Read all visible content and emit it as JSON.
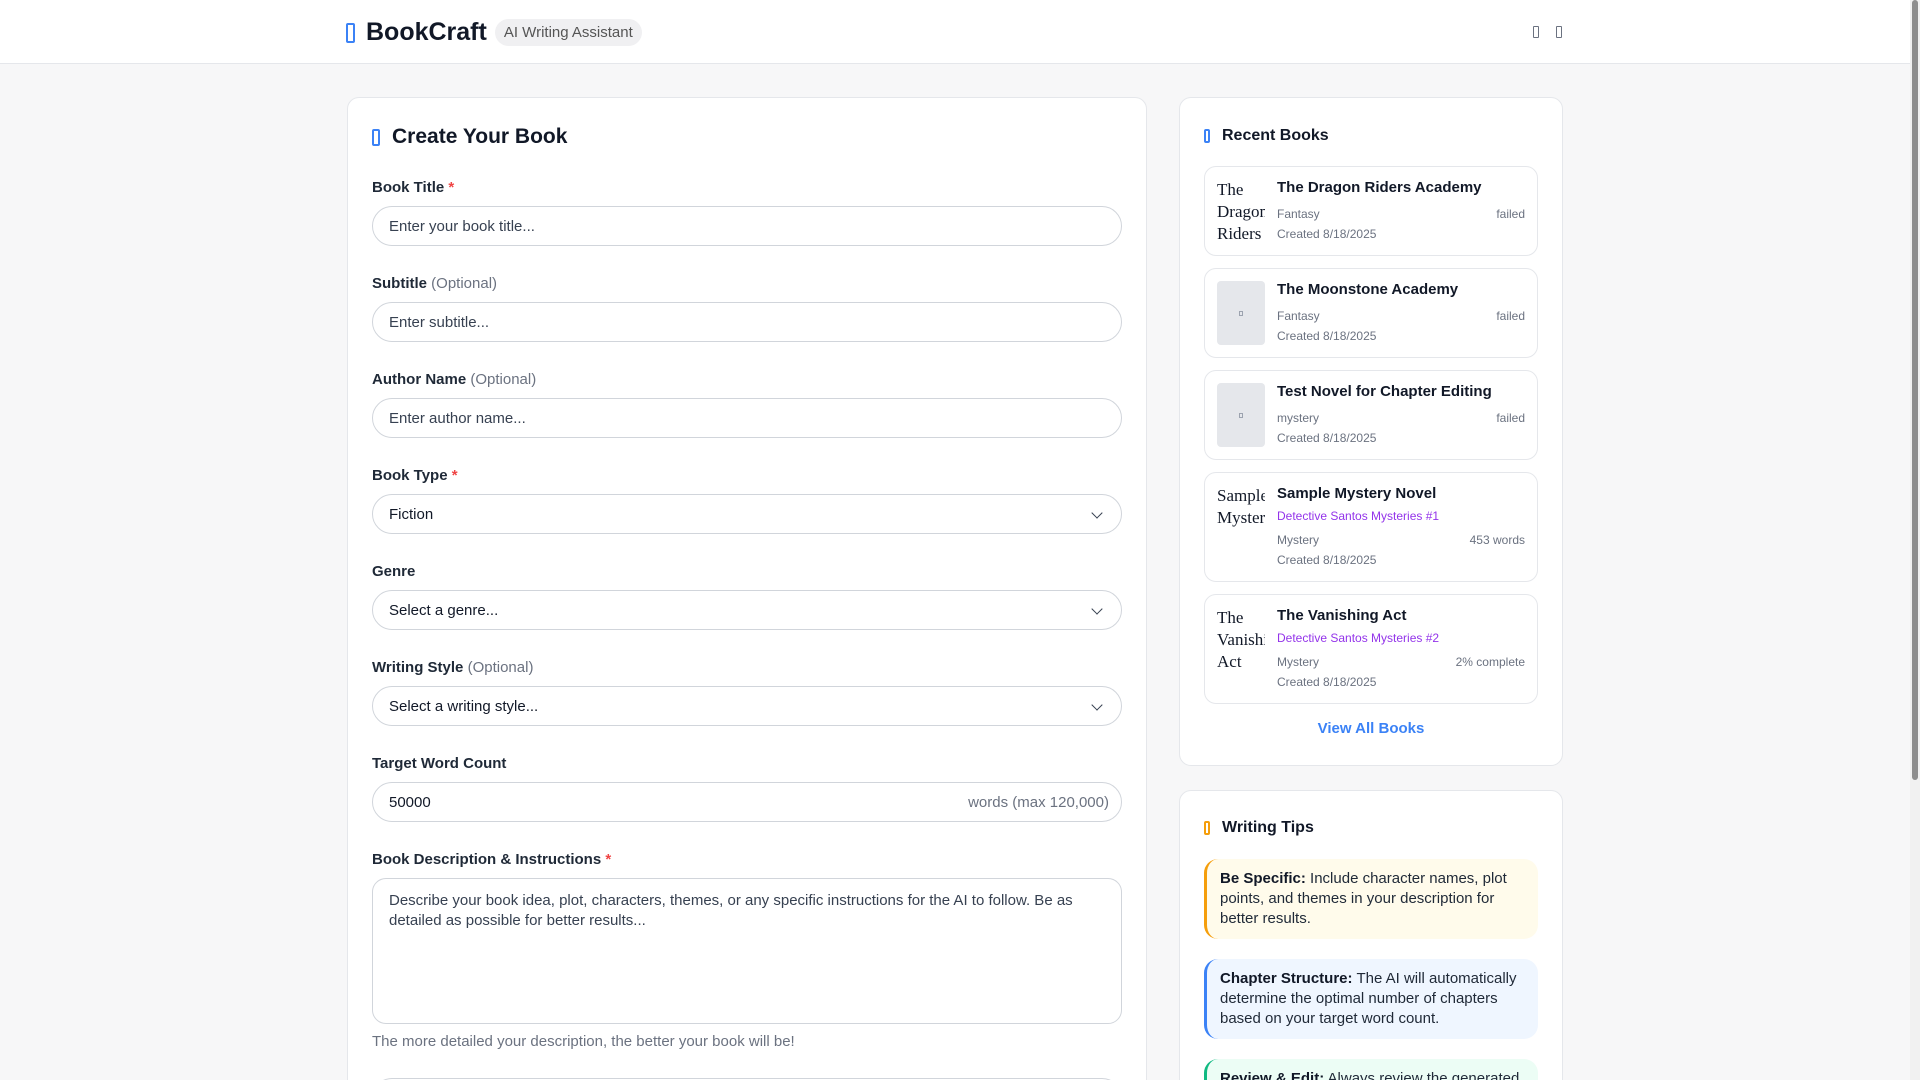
{
  "header": {
    "brand_name": "BookCraft",
    "brand_tag": "AI Writing Assistant",
    "brand_icon": "book-icon",
    "right_icons": [
      "user-icon",
      "menu-icon"
    ]
  },
  "form": {
    "title": "Create Your Book",
    "title_icon": "book-icon",
    "book_title": {
      "label": "Book Title",
      "required": "*",
      "placeholder": "Enter your book title..."
    },
    "subtitle": {
      "label": "Subtitle",
      "optional": "(Optional)",
      "placeholder": "Enter subtitle..."
    },
    "author": {
      "label": "Author Name",
      "optional": "(Optional)",
      "placeholder": "Enter author name..."
    },
    "book_type": {
      "label": "Book Type",
      "required": "*",
      "value": "Fiction"
    },
    "genre": {
      "label": "Genre",
      "value": "Select a genre..."
    },
    "writing_style": {
      "label": "Writing Style",
      "optional": "(Optional)",
      "value": "Select a writing style..."
    },
    "word_count": {
      "label": "Target Word Count",
      "value": "50000",
      "suffix": "words (max 120,000)"
    },
    "description": {
      "label": "Book Description & Instructions",
      "required": "*",
      "placeholder": "Describe your book idea, plot, characters, themes, or any specific instructions for the AI to follow. Be as detailed as possible for better results...",
      "hint": "The more detailed your description, the better your book will be!"
    }
  },
  "recent": {
    "title": "Recent Books",
    "title_icon": "book-icon",
    "books": [
      {
        "title": "The Dragon Riders Academy",
        "cover_alt": "The Dragon Riders Academy",
        "series": "",
        "genre": "Fantasy",
        "status": "failed",
        "created": "Created 8/18/2025"
      },
      {
        "title": "The Moonstone Academy",
        "cover_alt": "",
        "series": "",
        "genre": "Fantasy",
        "status": "failed",
        "created": "Created 8/18/2025"
      },
      {
        "title": "Test Novel for Chapter Editing",
        "cover_alt": "",
        "series": "",
        "genre": "mystery",
        "status": "failed",
        "created": "Created 8/18/2025"
      },
      {
        "title": "Sample Mystery Novel",
        "cover_alt": "Sample Mystery",
        "series": "Detective Santos Mysteries #1",
        "genre": "Mystery",
        "status": "453 words",
        "created": "Created 8/18/2025"
      },
      {
        "title": "The Vanishing Act",
        "cover_alt": "The Vanishing Act",
        "series": "Detective Santos Mysteries #2",
        "genre": "Mystery",
        "status": "2% complete",
        "created": "Created 8/18/2025"
      }
    ],
    "view_all": "View All Books"
  },
  "tips": {
    "title": "Writing Tips",
    "title_icon": "lightbulb-icon",
    "items": [
      {
        "heading": "Be Specific:",
        "text": "Include character names, plot points, and themes in your description for better results."
      },
      {
        "heading": "Chapter Structure:",
        "text": "The AI will automatically determine the optimal number of chapters based on your target word count."
      },
      {
        "heading": "Review & Edit:",
        "text": "Always review the generated"
      }
    ]
  },
  "colors": {
    "accent": "#3b82f6",
    "series": "#9333ea",
    "required": "#ef4444",
    "tip_warning": "#f59e0b"
  }
}
